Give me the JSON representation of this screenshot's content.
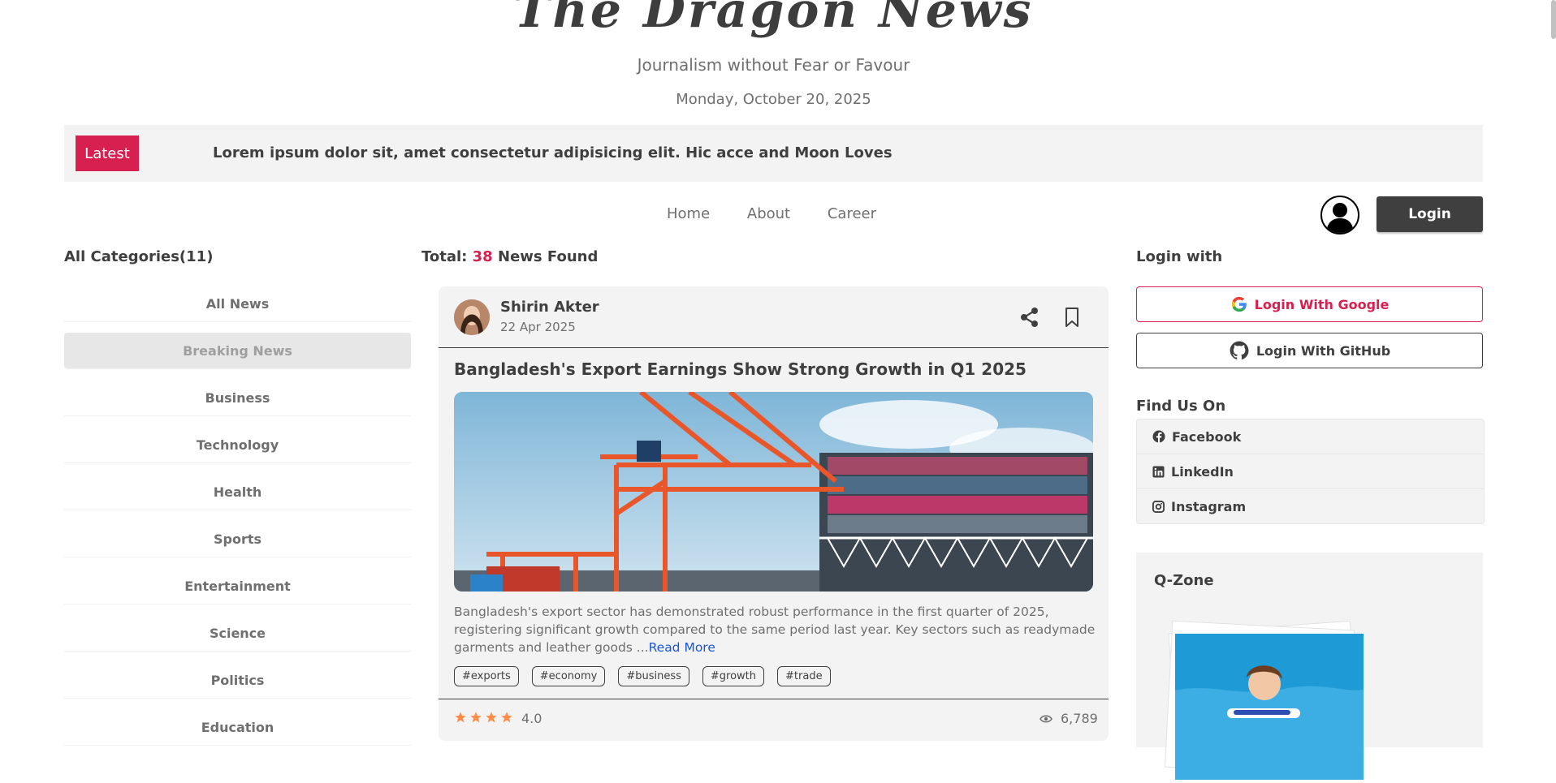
{
  "masthead": {
    "title": "The Dragon News",
    "tagline": "Journalism without Fear or Favour",
    "date": "Monday, October 20, 2025"
  },
  "ticker": {
    "label": "Latest",
    "text": "Lorem ipsum dolor sit, amet consectetur adipisicing elit. Hic acce and Moon Loves"
  },
  "nav": {
    "items": [
      "Home",
      "About",
      "Career"
    ],
    "login_label": "Login"
  },
  "categories": {
    "title": "All Categories(11)",
    "items": [
      "All News",
      "Breaking News",
      "Business",
      "Technology",
      "Health",
      "Sports",
      "Entertainment",
      "Science",
      "Politics",
      "Education"
    ],
    "active_index": 1
  },
  "news": {
    "total_prefix": "Total:",
    "total_count": "38",
    "total_suffix": "News Found",
    "card": {
      "author_name": "Shirin Akter",
      "published": "22 Apr 2025",
      "title": "Bangladesh's Export Earnings Show Strong Growth in Q1 2025",
      "description": "Bangladesh's export sector has demonstrated robust performance in the first quarter of 2025, registering significant growth compared to the same period last year. Key sectors such as readymade garments and leather goods ...",
      "read_more": "Read More",
      "tags": [
        "#exports",
        "#economy",
        "#business",
        "#growth",
        "#trade"
      ],
      "rating_stars": 4,
      "rating": "4.0",
      "views": "6,789"
    }
  },
  "right": {
    "login_title": "Login with",
    "google_label": "Login With Google",
    "github_label": "Login With GitHub",
    "find_title": "Find Us On",
    "social": [
      "Facebook",
      "LinkedIn",
      "Instagram"
    ],
    "qzone_title": "Q-Zone"
  },
  "colors": {
    "accent": "#d72050",
    "dark": "#403f3f",
    "muted": "#706f6f",
    "panel": "#f3f3f3",
    "star": "#ff8c47"
  }
}
